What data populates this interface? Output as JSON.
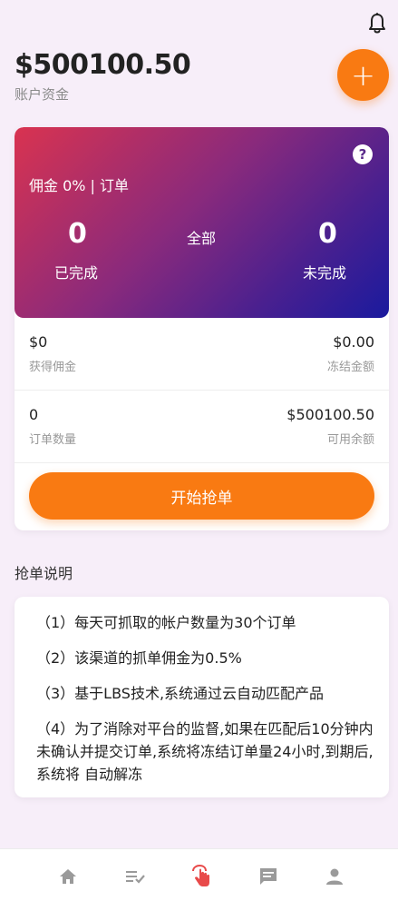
{
  "header": {
    "balance": "$500100.50",
    "balance_label": "账户资金",
    "bell_icon": "bell-icon",
    "fab_label": "+"
  },
  "hero": {
    "help_label": "?",
    "commission_text": "佣金 0% | 订单",
    "completed_count": "0",
    "completed_label": "已完成",
    "all_label": "全部",
    "pending_count": "0",
    "pending_label": "未完成"
  },
  "stats": {
    "earned_value": "$0",
    "earned_label": "获得佣金",
    "frozen_value": "$0.00",
    "frozen_label": "冻结金额",
    "orders_value": "0",
    "orders_label": "订单数量",
    "available_value": "$500100.50",
    "available_label": "可用余额"
  },
  "actions": {
    "start_label": "开始抢单"
  },
  "rules": {
    "title": "抢单说明",
    "items": [
      "（1）每天可抓取的帐户数量为30个订单",
      "（2）该渠道的抓单佣金为0.5%",
      "（3）基于LBS技术,系统通过云自动匹配产品",
      "（4）为了消除对平台的监督,如果在匹配后10分钟内未确认并提交订单,系统将冻结订单量24小时,到期后,系统将 自动解冻"
    ]
  },
  "tabbar": {
    "items": [
      "home-icon",
      "orders-list-icon",
      "grab-order-icon",
      "messages-icon",
      "profile-icon"
    ],
    "active_color": "#e84a4a",
    "inactive_color": "#9a9a9a"
  }
}
